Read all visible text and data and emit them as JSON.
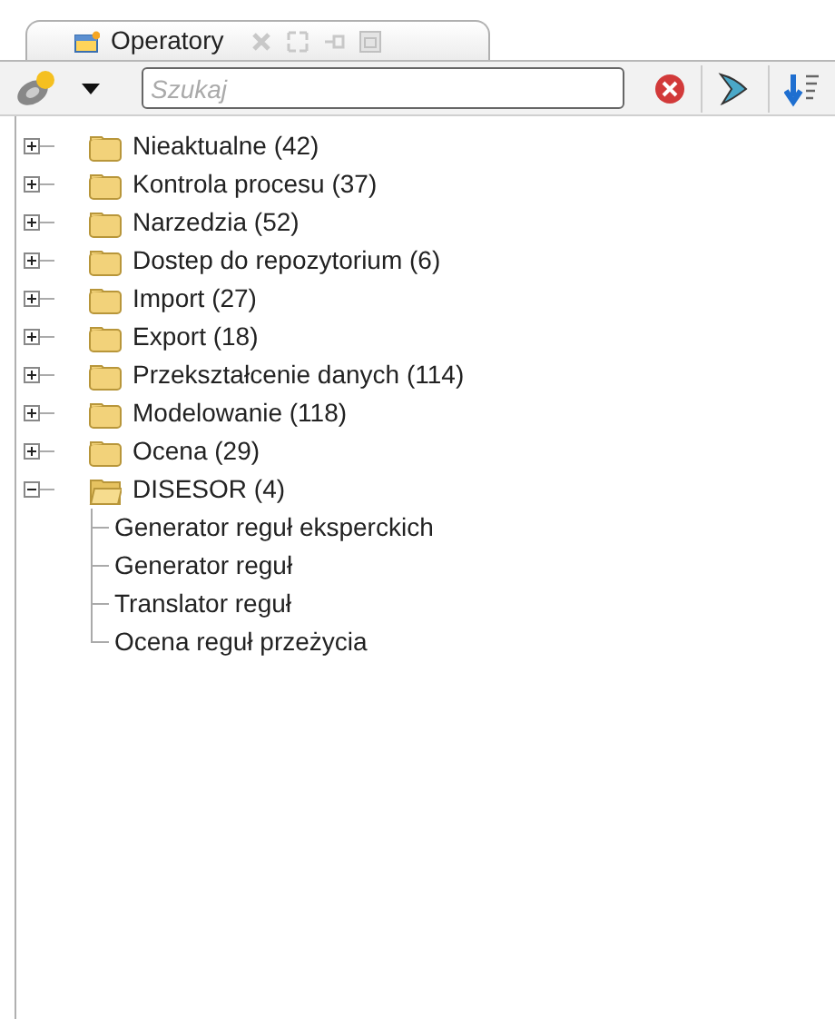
{
  "tab": {
    "label": "Operatory",
    "selected": true
  },
  "search": {
    "placeholder": "Szukaj"
  },
  "tree": [
    {
      "label": "Nieaktualne (42)",
      "expanded": false
    },
    {
      "label": "Kontrola procesu (37)",
      "expanded": false
    },
    {
      "label": "Narzedzia (52)",
      "expanded": false
    },
    {
      "label": "Dostep do repozytorium (6)",
      "expanded": false
    },
    {
      "label": "Import (27)",
      "expanded": false
    },
    {
      "label": "Export (18)",
      "expanded": false
    },
    {
      "label": "Przekształcenie danych (114)",
      "expanded": false
    },
    {
      "label": "Modelowanie (118)",
      "expanded": false
    },
    {
      "label": "Ocena (29)",
      "expanded": false
    },
    {
      "label": "DISESOR (4)",
      "expanded": true,
      "children": [
        {
          "label": "Generator reguł eksperckich"
        },
        {
          "label": "Generator reguł"
        },
        {
          "label": "Translator reguł"
        },
        {
          "label": "Ocena reguł przeżycia"
        }
      ]
    }
  ]
}
